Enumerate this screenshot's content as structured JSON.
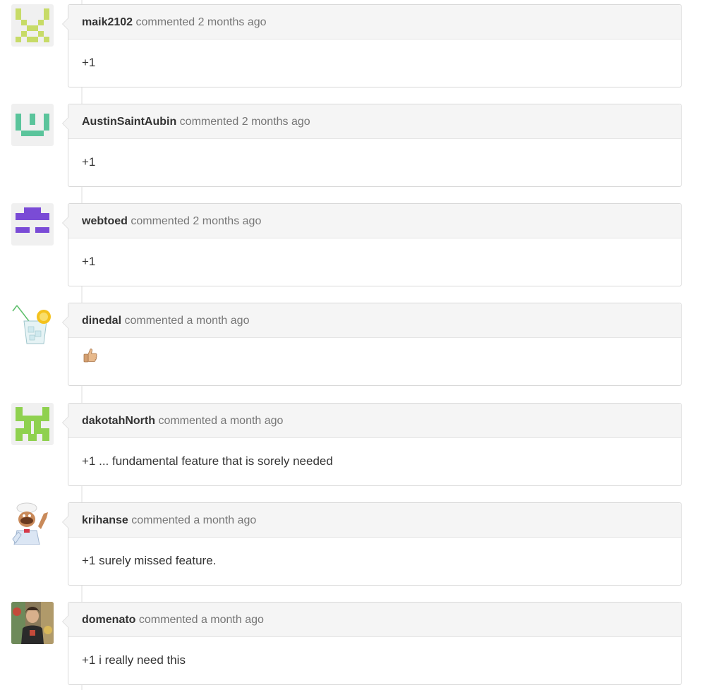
{
  "comments": [
    {
      "author": "maik2102",
      "action": "commented",
      "time": "2 months ago",
      "body": "+1",
      "avatar": "identicon-lime"
    },
    {
      "author": "AustinSaintAubin",
      "action": "commented",
      "time": "2 months ago",
      "body": "+1",
      "avatar": "identicon-teal"
    },
    {
      "author": "webtoed",
      "action": "commented",
      "time": "2 months ago",
      "body": "+1",
      "avatar": "identicon-purple"
    },
    {
      "author": "dinedal",
      "action": "commented",
      "time": "a month ago",
      "body": "",
      "body_icon": "thumbs-up-icon",
      "avatar": "glass-of-lemonade-photo"
    },
    {
      "author": "dakotahNorth",
      "action": "commented",
      "time": "a month ago",
      "body": "+1 ... fundamental feature that is sorely needed",
      "avatar": "identicon-green"
    },
    {
      "author": "krihanse",
      "action": "commented",
      "time": "a month ago",
      "body": "+1 surely missed feature.",
      "avatar": "swedish-chef-photo"
    },
    {
      "author": "domenato",
      "action": "commented",
      "time": "a month ago",
      "body": "+1 i really need this",
      "avatar": "user-photo"
    }
  ],
  "colors": {
    "header_bg": "#f5f5f5",
    "border": "#d8d8d8",
    "author": "#333333",
    "meta": "#767676",
    "identicon_lime": "#c7db67",
    "identicon_teal": "#5ac49b",
    "identicon_purple": "#7a4bd6",
    "identicon_green": "#8fd14f"
  }
}
